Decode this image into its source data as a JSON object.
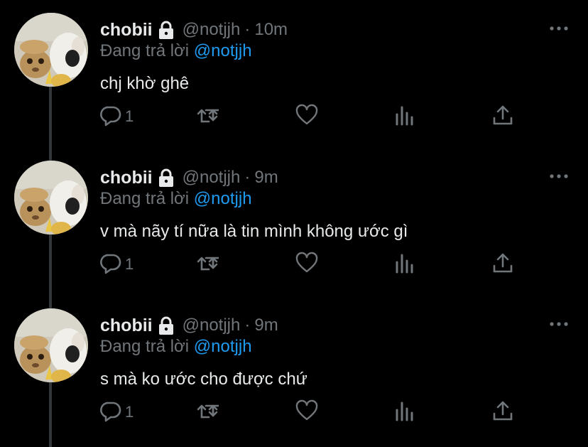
{
  "tweets": [
    {
      "name": "chobii",
      "handle": "@notjjh",
      "separator": "·",
      "time": "10m",
      "reply_prefix": "Đang trả lời",
      "reply_to": "@notjjh",
      "text": "chj khờ ghê",
      "reply_count": "1"
    },
    {
      "name": "chobii",
      "handle": "@notjjh",
      "separator": "·",
      "time": "9m",
      "reply_prefix": "Đang trả lời",
      "reply_to": "@notjjh",
      "text": "v mà nãy tí nữa là tin mình không ước gì",
      "reply_count": "1"
    },
    {
      "name": "chobii",
      "handle": "@notjjh",
      "separator": "·",
      "time": "9m",
      "reply_prefix": "Đang trả lời",
      "reply_to": "@notjjh",
      "text": "s mà ko ước cho được chứ",
      "reply_count": "1"
    }
  ],
  "icons": {
    "lock": "lock-icon",
    "reply": "reply-icon",
    "retweet": "retweet-icon",
    "like": "heart-icon",
    "views": "analytics-icon",
    "share": "share-icon",
    "more": "more-icon"
  },
  "colors": {
    "background": "#000000",
    "text": "#e7e9ea",
    "muted": "#71767b",
    "link": "#1d9bf0",
    "thread_line": "#333639"
  }
}
